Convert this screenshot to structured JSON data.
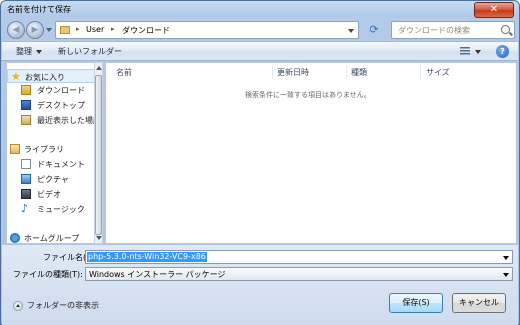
{
  "window": {
    "title": "名前を付けて保存",
    "close_glyph": "✕"
  },
  "nav": {
    "back_glyph": "◀",
    "forward_glyph": "▶",
    "breadcrumb": [
      "User",
      "ダウンロード"
    ],
    "breadcrumb_separator": "▸",
    "refresh_glyph": "⟳",
    "search_placeholder": "ダウンロードの検索"
  },
  "toolbar": {
    "organize": "整理",
    "new_folder": "新しいフォルダー",
    "help_glyph": "?"
  },
  "sidebar": {
    "favorites": {
      "label": "お気に入り",
      "icon": "star-icon",
      "items": [
        {
          "label": "ダウンロード",
          "icon": "downloads-folder-icon"
        },
        {
          "label": "デスクトップ",
          "icon": "desktop-icon"
        },
        {
          "label": "最近表示した場所",
          "icon": "recent-places-icon"
        }
      ]
    },
    "libraries": {
      "label": "ライブラリ",
      "icon": "library-icon",
      "items": [
        {
          "label": "ドキュメント",
          "icon": "documents-icon"
        },
        {
          "label": "ピクチャ",
          "icon": "pictures-icon"
        },
        {
          "label": "ビデオ",
          "icon": "videos-icon"
        },
        {
          "label": "ミュージック",
          "icon": "music-icon"
        }
      ]
    },
    "homegroup": {
      "label": "ホームグループ",
      "icon": "homegroup-icon"
    }
  },
  "content": {
    "columns": [
      "名前",
      "更新日時",
      "種類",
      "サイズ"
    ],
    "empty_message": "検索条件に一致する項目はありません。"
  },
  "footer": {
    "filename_label": "ファイル名(N):",
    "filename_value": "php-5.3.0-nts-Win32-VC9-x86",
    "filetype_label": "ファイルの種類(T):",
    "filetype_value": "Windows インストーラー パッケージ",
    "hide_folders": "フォルダーの非表示",
    "save_button": "保存(S)",
    "cancel_button": "キャンセル"
  },
  "colors": {
    "selection": "#3399ff",
    "titlebar": "#b3cbe8",
    "close_button": "#c2381b"
  }
}
